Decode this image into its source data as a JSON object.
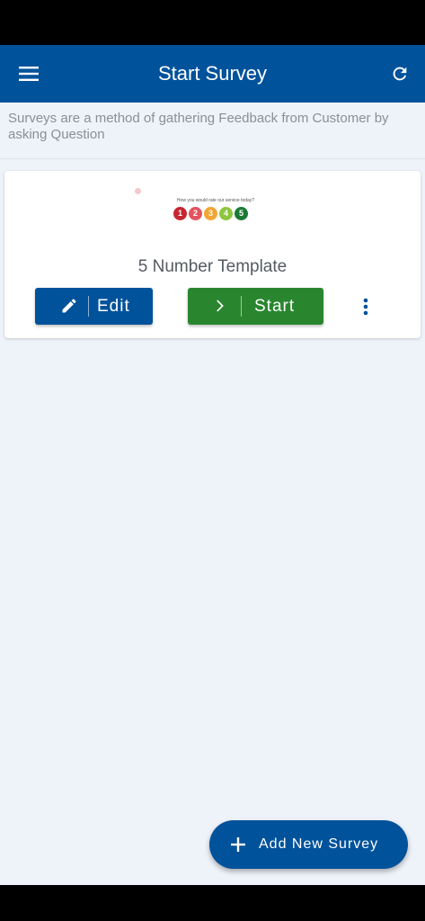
{
  "app_bar": {
    "title": "Start Survey",
    "menu_icon": "menu-icon",
    "refresh_icon": "refresh-icon",
    "color": "#00529b"
  },
  "description": "Surveys are a method of gathering Feedback from Customer by asking Question",
  "survey_card": {
    "preview": {
      "question": "How you would rate our service today?",
      "ratings": [
        {
          "label": "1",
          "color": "#c62631"
        },
        {
          "label": "2",
          "color": "#e2535f"
        },
        {
          "label": "3",
          "color": "#f3a533"
        },
        {
          "label": "4",
          "color": "#8dc63f"
        },
        {
          "label": "5",
          "color": "#1a7a35"
        }
      ]
    },
    "template_name": "5 Number Template",
    "edit_label": "Edit",
    "edit_icon": "pencil-icon",
    "start_label": "Start",
    "start_icon": "chevron-right-icon",
    "more_icon": "more-vertical-icon",
    "edit_color": "#00529b",
    "start_color": "#2a862e"
  },
  "fab": {
    "label": "Add New Survey",
    "icon": "plus-icon"
  }
}
